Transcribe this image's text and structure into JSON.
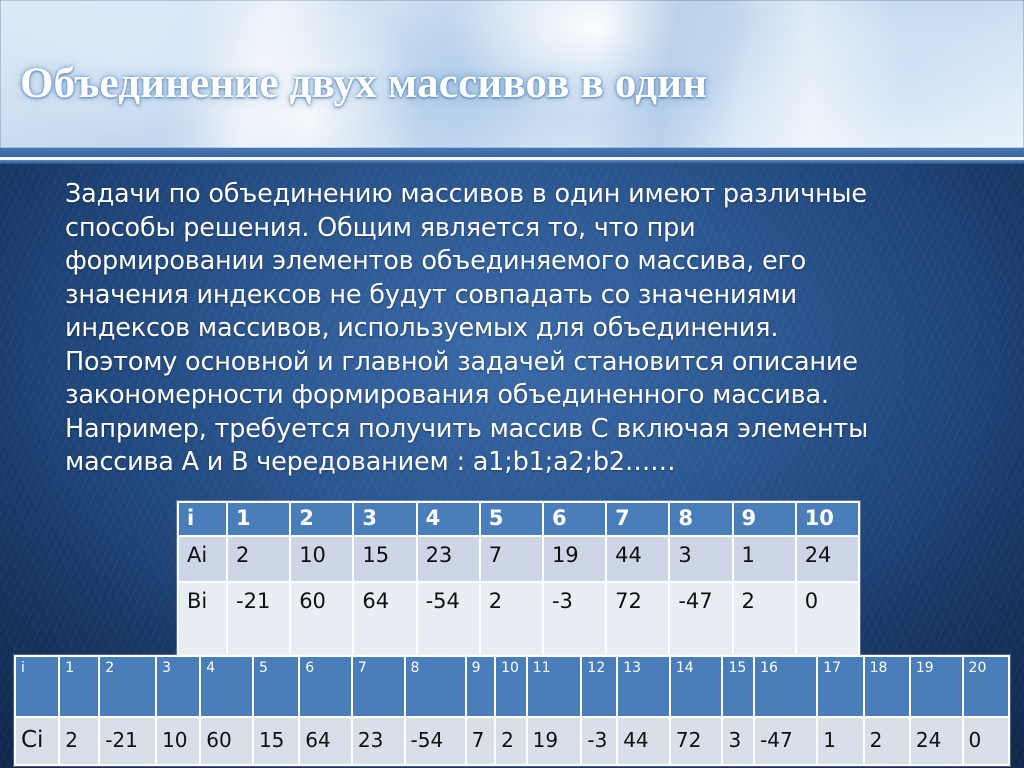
{
  "slide": {
    "title": "Объединение двух массивов в один",
    "body_lines": [
      "Задачи по объединению массивов в один имеют различные",
      "способы решения. Общим является то, что при",
      "формировании элементов объединяемого массива, его",
      "значения индексов не будут совпадать со значениями",
      "индексов массивов, используемых для объединения.",
      "Поэтому основной и главной задачей становится описание",
      "закономерности формирования объединенного массива.",
      "Например, требуется получить массив С включая элементы",
      "массива А и В чередованием : a1;b1;a2;b2……"
    ],
    "body_text": "Задачи по объединению массивов в один имеют различные способы решения. Общим является то, что при формировании элементов объединяемого массива, его значения индексов не будут совпадать со значениями индексов массивов, используемых для объединения. Поэтому основной и главной задачей становится описание закономерности формирования объединенного массива. Например, требуется получить массив С включая элементы массива А и В чередованием : a1;b1;a2;b2……"
  },
  "colors": {
    "header_cell": "#4a7ebb",
    "row_a": "#ccd6e6",
    "row_b": "#e9edf4",
    "row_c": "#d9dfe9",
    "background_dark": "#102a4e",
    "background_light": "#3a6aa8",
    "text": "#ffffff"
  },
  "table_ab": {
    "headers": [
      "i",
      "1",
      "2",
      "3",
      "4",
      "5",
      "6",
      "7",
      "8",
      "9",
      "10"
    ],
    "rows": [
      {
        "label": "Ai",
        "values": [
          "2",
          "10",
          "15",
          "23",
          "7",
          "19",
          "44",
          "3",
          "1",
          "24"
        ]
      },
      {
        "label": "Bi",
        "values": [
          "-21",
          "60",
          "64",
          "-54",
          "2",
          "-3",
          "72",
          "-47",
          "2",
          "0"
        ]
      }
    ]
  },
  "table_c": {
    "headers": [
      "i",
      "1",
      "2",
      "3",
      "4",
      "5",
      "6",
      "7",
      "8",
      "9",
      "10",
      "11",
      "12",
      "13",
      "14",
      "15",
      "16",
      "17",
      "18",
      "19",
      "20"
    ],
    "rows": [
      {
        "label": "Ci",
        "values": [
          "2",
          "-21",
          "10",
          "60",
          "15",
          "64",
          "23",
          "-54",
          "7",
          "2",
          "19",
          "-3",
          "44",
          "72",
          "3",
          "-47",
          "1",
          "2",
          "24",
          "0"
        ]
      }
    ]
  }
}
